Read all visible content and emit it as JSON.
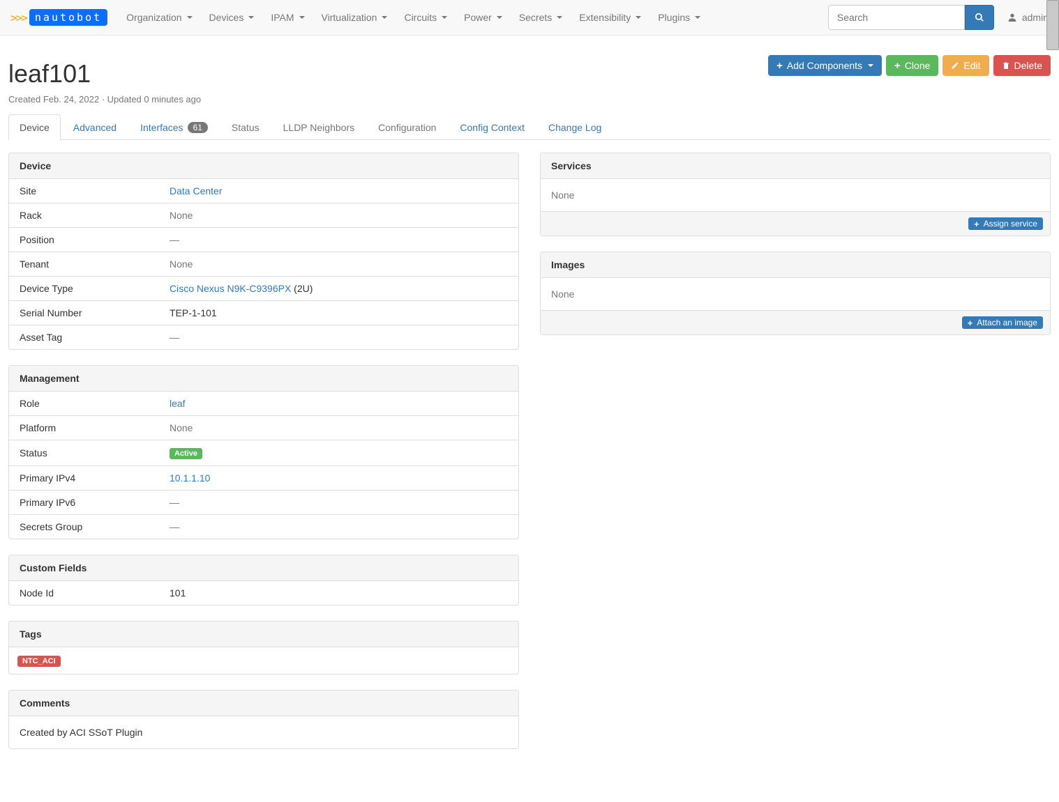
{
  "brand": "nautobot",
  "nav": [
    "Organization",
    "Devices",
    "IPAM",
    "Virtualization",
    "Circuits",
    "Power",
    "Secrets",
    "Extensibility",
    "Plugins"
  ],
  "search": {
    "placeholder": "Search"
  },
  "user": "admin",
  "buttons": {
    "addComponents": "Add Components",
    "clone": "Clone",
    "edit": "Edit",
    "delete": "Delete",
    "assignService": "Assign service",
    "attachImage": "Attach an image"
  },
  "title": "leaf101",
  "meta": "Created Feb. 24, 2022 · Updated 0 minutes ago",
  "tabs": {
    "device": "Device",
    "advanced": "Advanced",
    "interfaces": "Interfaces",
    "interfacesCount": "61",
    "status": "Status",
    "lldp": "LLDP Neighbors",
    "configuration": "Configuration",
    "configContext": "Config Context",
    "changeLog": "Change Log"
  },
  "panels": {
    "device": "Device",
    "management": "Management",
    "customFields": "Custom Fields",
    "tags": "Tags",
    "comments": "Comments",
    "services": "Services",
    "images": "Images"
  },
  "device": {
    "siteK": "Site",
    "siteV": "Data Center",
    "rackK": "Rack",
    "rackV": "None",
    "positionK": "Position",
    "positionV": "—",
    "tenantK": "Tenant",
    "tenantV": "None",
    "typeK": "Device Type",
    "typeLink": "Cisco Nexus N9K-C9396PX",
    "typeSuffix": " (2U)",
    "serialK": "Serial Number",
    "serialV": "TEP-1-101",
    "assetK": "Asset Tag",
    "assetV": "—"
  },
  "mgmt": {
    "roleK": "Role",
    "roleV": "leaf",
    "platformK": "Platform",
    "platformV": "None",
    "statusK": "Status",
    "statusV": "Active",
    "ip4K": "Primary IPv4",
    "ip4V": "10.1.1.10",
    "ip6K": "Primary IPv6",
    "ip6V": "—",
    "secretsK": "Secrets Group",
    "secretsV": "—"
  },
  "custom": {
    "nodeIdK": "Node Id",
    "nodeIdV": "101"
  },
  "tagValue": "NTC_ACI",
  "comments": "Created by ACI SSoT Plugin",
  "none": "None"
}
